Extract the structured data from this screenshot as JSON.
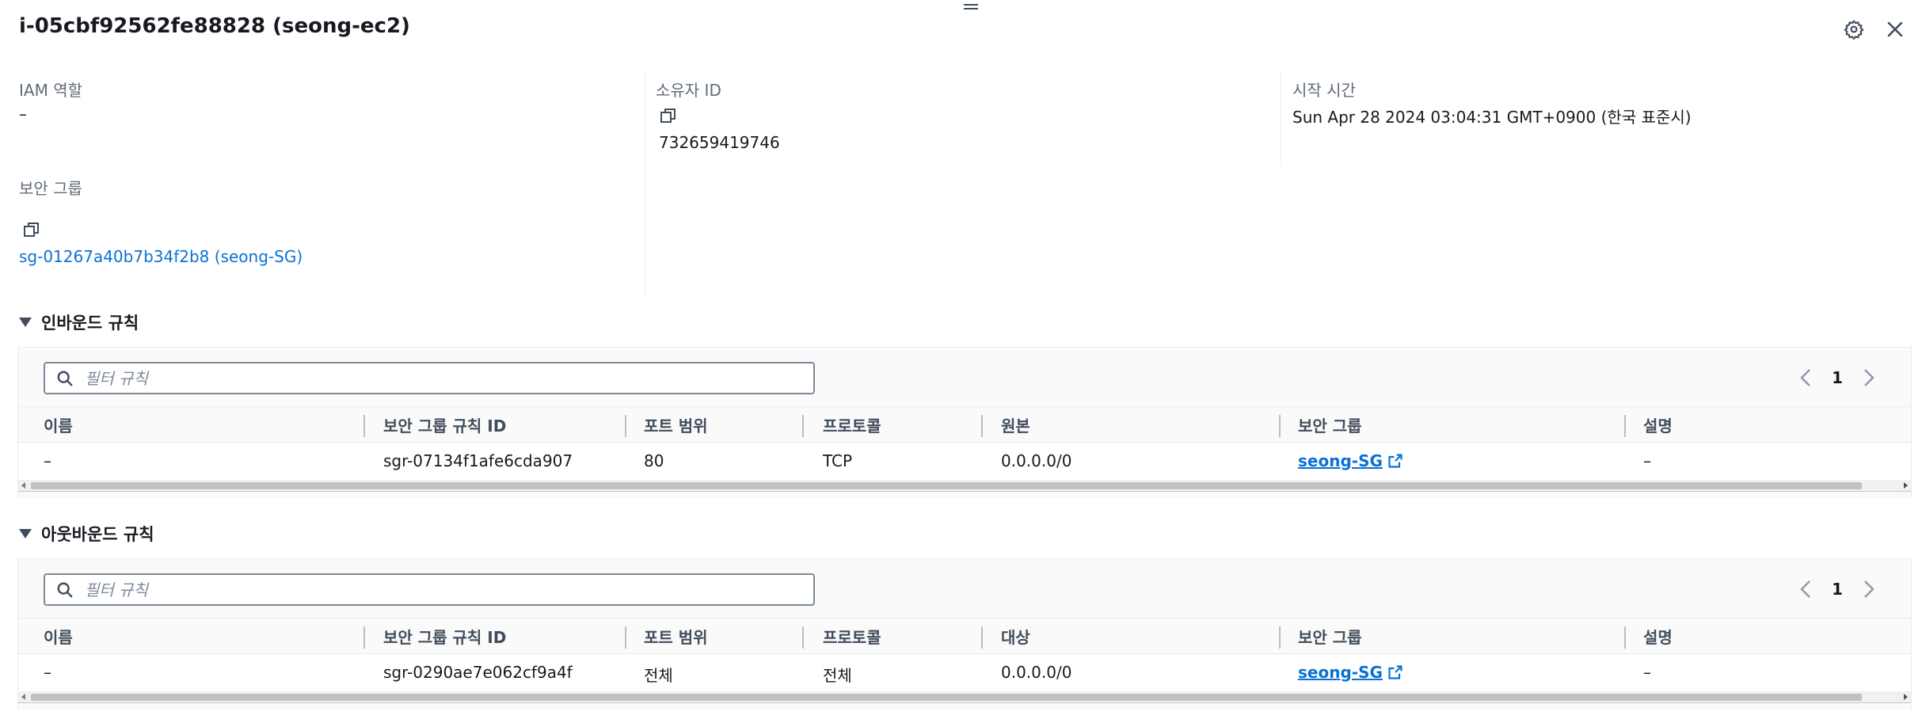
{
  "header": {
    "title": "i-05cbf92562fe88828 (seong-ec2)",
    "settings_icon": "gear-icon",
    "close_icon": "close-icon"
  },
  "details": {
    "iam_role": {
      "label": "IAM 역할",
      "value": "–"
    },
    "owner_id": {
      "label": "소유자 ID",
      "value": "732659419746"
    },
    "launch_time": {
      "label": "시작 시간",
      "value": "Sun Apr 28 2024 03:04:31 GMT+0900 (한국 표준시)"
    },
    "security_groups": {
      "label": "보안 그룹",
      "value": "sg-01267a40b7b34f2b8 (seong-SG)"
    }
  },
  "inbound": {
    "title": "인바운드 규칙",
    "filter_placeholder": "필터 규칙",
    "page": "1",
    "columns": [
      "이름",
      "보안 그룹 규칙 ID",
      "포트 범위",
      "프로토콜",
      "원본",
      "보안 그룹",
      "설명"
    ],
    "rows": [
      {
        "name": "–",
        "rule_id": "sgr-07134f1afe6cda907",
        "port": "80",
        "protocol": "TCP",
        "source": "0.0.0.0/0",
        "sg": "seong-SG",
        "desc": "–"
      }
    ]
  },
  "outbound": {
    "title": "아웃바운드 규칙",
    "filter_placeholder": "필터 규칙",
    "page": "1",
    "columns": [
      "이름",
      "보안 그룹 규칙 ID",
      "포트 범위",
      "프로토콜",
      "대상",
      "보안 그룹",
      "설명"
    ],
    "rows": [
      {
        "name": "–",
        "rule_id": "sgr-0290ae7e062cf9a4f",
        "port": "전체",
        "protocol": "전체",
        "dest": "0.0.0.0/0",
        "sg": "seong-SG",
        "desc": "–"
      }
    ]
  },
  "colors": {
    "link": "#0972d3",
    "text": "#16191f",
    "label": "#5f6b7a"
  }
}
